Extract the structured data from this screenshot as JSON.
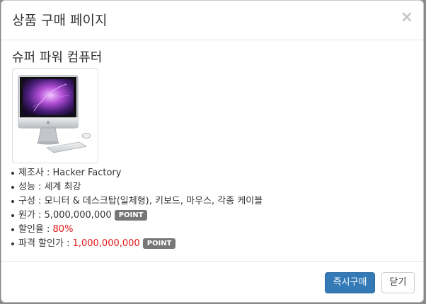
{
  "modal": {
    "title": "상품 구매 페이지",
    "close_label": "×"
  },
  "product": {
    "name": "슈퍼 파워 컴퓨터",
    "image_icon": "computer-image",
    "specs": {
      "maker_label": "제조사 : ",
      "maker_value": "Hacker Factory",
      "performance_label": "성능 : ",
      "performance_value": "세계 최강",
      "composition_label": "구성 : ",
      "composition_value": "모니터 & 데스크탑(일체형), 키보드, 마우스, 각종 케이블",
      "original_price_label": "원가 : ",
      "original_price_value": "5,000,000,000",
      "original_price_unit": "POINT",
      "discount_rate_label": "할인율 : ",
      "discount_rate_value": "80%",
      "sale_price_label": "파격 할인가 : ",
      "sale_price_value": "1,000,000,000",
      "sale_price_unit": "POINT"
    }
  },
  "footer": {
    "buy_label": "즉시구매",
    "close_label": "닫기"
  },
  "colors": {
    "primary": "#337ab7",
    "highlight_red": "#e21818",
    "badge": "#777777"
  }
}
